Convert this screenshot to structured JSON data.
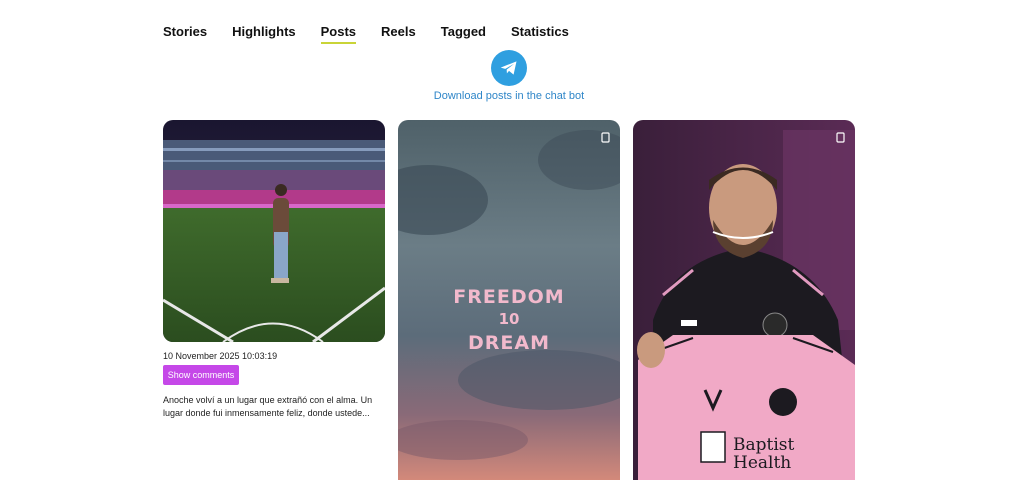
{
  "tabs": [
    {
      "label": "Stories"
    },
    {
      "label": "Highlights"
    },
    {
      "label": "Posts"
    },
    {
      "label": "Reels"
    },
    {
      "label": "Tagged"
    },
    {
      "label": "Statistics"
    }
  ],
  "active_tab": "Posts",
  "telegram": {
    "icon": "telegram-icon",
    "link_text": "Download posts in the chat bot",
    "color": "#2f9fe0"
  },
  "posts": [
    {
      "date": "10 November 2025 10:03:19",
      "show_comments_label": "Show comments",
      "caption": "Anoche volví a un lugar que extrañó con el alma. Un lugar donde fui inmensamente feliz, donde ustede..."
    },
    {
      "image_text": {
        "line1": "FREEDOM",
        "line2": "10",
        "line3": "DREAM"
      },
      "badge_icon": "multi-media-icon"
    },
    {
      "badge_icon": "multi-media-icon"
    }
  ],
  "colors": {
    "accent_underline": "#c9d437",
    "comments_button": "#c548e8",
    "link": "#2f86c8"
  }
}
